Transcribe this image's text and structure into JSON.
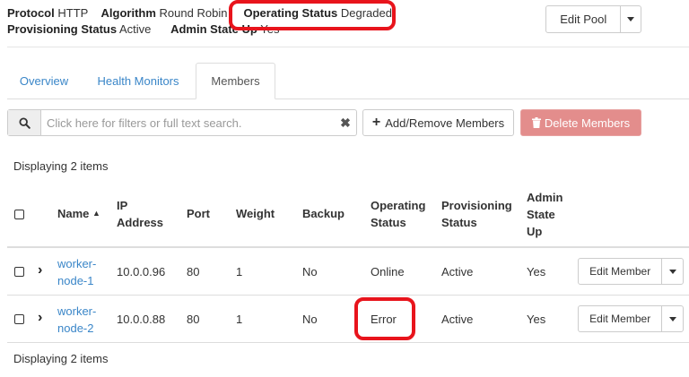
{
  "header": {
    "protocol_label": "Protocol",
    "protocol_value": "HTTP",
    "algorithm_label": "Algorithm",
    "algorithm_value": "Round Robin",
    "operating_status_label": "Operating Status",
    "operating_status_value": "Degraded",
    "provisioning_status_label": "Provisioning Status",
    "provisioning_status_value": "Active",
    "admin_state_label": "Admin State Up",
    "admin_state_value": "Yes"
  },
  "edit_pool_label": "Edit Pool",
  "tabs": [
    {
      "label": "Overview"
    },
    {
      "label": "Health Monitors"
    },
    {
      "label": "Members"
    }
  ],
  "active_tab": "Members",
  "search": {
    "placeholder": "Click here for filters or full text search.",
    "clear_icon": "✖"
  },
  "actions": {
    "add_remove_label": "Add/Remove Members",
    "delete_label": "Delete Members"
  },
  "table": {
    "count_label": "Displaying 2 items",
    "columns": {
      "name": "Name",
      "ip_address_1": "IP",
      "ip_address_2": "Address",
      "port": "Port",
      "weight": "Weight",
      "backup": "Backup",
      "operating_status_1": "Operating",
      "operating_status_2": "Status",
      "provisioning_status_1": "Provisioning",
      "provisioning_status_2": "Status",
      "admin_state_1": "Admin",
      "admin_state_2": "State",
      "admin_state_3": "Up"
    },
    "rows": [
      {
        "name_1": "worker-",
        "name_2": "node-1",
        "ip": "10.0.0.96",
        "port": "80",
        "weight": "1",
        "backup": "No",
        "operating_status": "Online",
        "provisioning_status": "Active",
        "admin_state": "Yes",
        "action_label": "Edit Member"
      },
      {
        "name_1": "worker-",
        "name_2": "node-2",
        "ip": "10.0.0.88",
        "port": "80",
        "weight": "1",
        "backup": "No",
        "operating_status": "Error",
        "provisioning_status": "Active",
        "admin_state": "Yes",
        "action_label": "Edit Member"
      }
    ],
    "footer_count_label": "Displaying 2 items"
  },
  "colors": {
    "link": "#3a86c8",
    "highlight_annotation": "#e8141c",
    "danger_button": "#e38d8c"
  },
  "icons": {
    "search": "search-icon",
    "clear": "close-icon",
    "add": "plus-icon",
    "delete": "trash-icon",
    "sort": "sort-ascending-icon",
    "expand": "chevron-right-icon",
    "dropdown": "caret-down-icon"
  }
}
